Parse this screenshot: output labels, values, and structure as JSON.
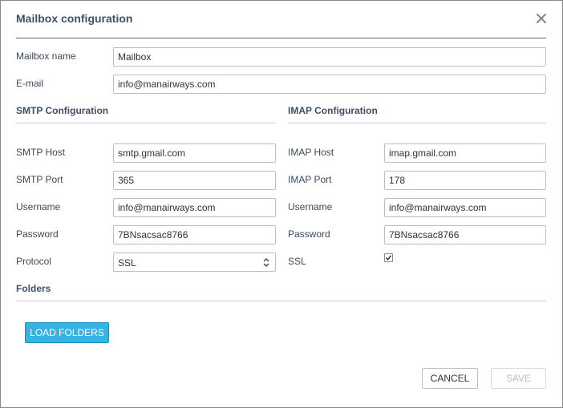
{
  "dialog": {
    "title": "Mailbox configuration"
  },
  "general": {
    "mailbox_name_label": "Mailbox name",
    "mailbox_name_value": "Mailbox",
    "email_label": "E-mail",
    "email_value": "info@manairways.com"
  },
  "smtp": {
    "heading": "SMTP Configuration",
    "host_label": "SMTP Host",
    "host_value": "smtp.gmail.com",
    "port_label": "SMTP Port",
    "port_value": "365",
    "username_label": "Username",
    "username_value": "info@manairways.com",
    "password_label": "Password",
    "password_value": "7BNsacsac8766",
    "protocol_label": "Protocol",
    "protocol_value": "SSL"
  },
  "imap": {
    "heading": "IMAP Configuration",
    "host_label": "IMAP Host",
    "host_value": "imap.gmail.com",
    "port_label": "IMAP Port",
    "port_value": "178",
    "username_label": "Username",
    "username_value": "info@manairways.com",
    "password_label": "Password",
    "password_value": "7BNsacsac8766",
    "ssl_label": "SSL",
    "ssl_checked": true
  },
  "folders": {
    "heading": "Folders",
    "load_button": "LOAD FOLDERS"
  },
  "footer": {
    "cancel_label": "CANCEL",
    "save_label": "SAVE"
  },
  "icons": {
    "close": "close-icon",
    "select_chevron": "chevron-up-down-icon",
    "checkmark": "checkmark-icon"
  },
  "colors": {
    "primary_button": "#36b2e3",
    "title_text": "#3f4f66"
  }
}
